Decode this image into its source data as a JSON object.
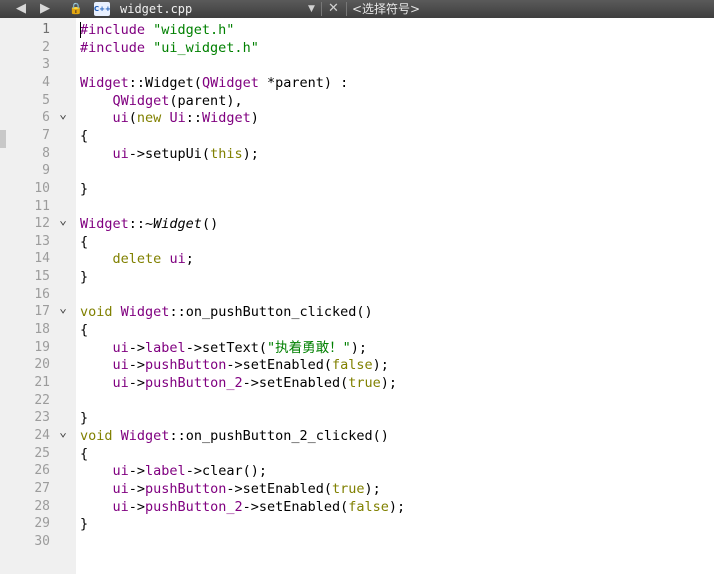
{
  "toolbar": {
    "back_icon": "◀",
    "forward_icon": "▶",
    "lock_icon": "🔒",
    "file_type_icon": "C++",
    "file_name": "widget.cpp",
    "dropdown_icon": "▼",
    "close_icon": "✕",
    "symbol_selector": "<选择符号>"
  },
  "editor": {
    "current_line": 1,
    "lines": [
      {
        "n": "1",
        "fold": "",
        "code": [
          [
            "t",
            "#include"
          ],
          [
            "",
            ""
          ],
          [
            "s",
            " \"widget.h\""
          ]
        ]
      },
      {
        "n": "2",
        "fold": "",
        "code": [
          [
            "t",
            "#include"
          ],
          [
            "s",
            " \"ui_widget.h\""
          ]
        ]
      },
      {
        "n": "3",
        "fold": "",
        "code": []
      },
      {
        "n": "4",
        "fold": "",
        "code": [
          [
            "t",
            "Widget"
          ],
          [
            "",
            "::Widget("
          ],
          [
            "t",
            "QWidget"
          ],
          [
            "",
            " *parent) :"
          ]
        ]
      },
      {
        "n": "5",
        "fold": "",
        "code": [
          [
            "",
            "    "
          ],
          [
            "t",
            "QWidget"
          ],
          [
            "",
            "(parent),"
          ]
        ]
      },
      {
        "n": "6",
        "fold": "v",
        "code": [
          [
            "",
            "    "
          ],
          [
            "t",
            "ui"
          ],
          [
            "",
            "("
          ],
          [
            "k",
            "new"
          ],
          [
            "",
            " "
          ],
          [
            "t",
            "Ui"
          ],
          [
            "",
            "::"
          ],
          [
            "t",
            "Widget"
          ],
          [
            "",
            ")"
          ]
        ]
      },
      {
        "n": "7",
        "fold": "",
        "code": [
          [
            "",
            "{"
          ]
        ]
      },
      {
        "n": "8",
        "fold": "",
        "code": [
          [
            "",
            "    "
          ],
          [
            "t",
            "ui"
          ],
          [
            "",
            "->setupUi("
          ],
          [
            "k",
            "this"
          ],
          [
            "",
            ");"
          ]
        ]
      },
      {
        "n": "9",
        "fold": "",
        "code": []
      },
      {
        "n": "10",
        "fold": "",
        "code": [
          [
            "",
            "}"
          ]
        ]
      },
      {
        "n": "11",
        "fold": "",
        "code": []
      },
      {
        "n": "12",
        "fold": "v",
        "code": [
          [
            "t",
            "Widget"
          ],
          [
            "",
            "::~"
          ],
          [
            "i",
            "Widget"
          ],
          [
            "",
            "()"
          ]
        ]
      },
      {
        "n": "13",
        "fold": "",
        "code": [
          [
            "",
            "{"
          ]
        ]
      },
      {
        "n": "14",
        "fold": "",
        "code": [
          [
            "",
            "    "
          ],
          [
            "k",
            "delete"
          ],
          [
            "",
            " "
          ],
          [
            "t",
            "ui"
          ],
          [
            "",
            ";"
          ]
        ]
      },
      {
        "n": "15",
        "fold": "",
        "code": [
          [
            "",
            "}"
          ]
        ]
      },
      {
        "n": "16",
        "fold": "",
        "code": []
      },
      {
        "n": "17",
        "fold": "v",
        "code": [
          [
            "k",
            "void"
          ],
          [
            "",
            " "
          ],
          [
            "t",
            "Widget"
          ],
          [
            "",
            "::on_pushButton_clicked()"
          ]
        ]
      },
      {
        "n": "18",
        "fold": "",
        "code": [
          [
            "",
            "{"
          ]
        ]
      },
      {
        "n": "19",
        "fold": "",
        "code": [
          [
            "",
            "    "
          ],
          [
            "t",
            "ui"
          ],
          [
            "",
            "->"
          ],
          [
            "t",
            "label"
          ],
          [
            "",
            "->setText("
          ],
          [
            "s",
            "\"执着勇敢！\""
          ],
          [
            "",
            ");"
          ]
        ]
      },
      {
        "n": "20",
        "fold": "",
        "code": [
          [
            "",
            "    "
          ],
          [
            "t",
            "ui"
          ],
          [
            "",
            "->"
          ],
          [
            "t",
            "pushButton"
          ],
          [
            "",
            "->setEnabled("
          ],
          [
            "k",
            "false"
          ],
          [
            "",
            ");"
          ]
        ]
      },
      {
        "n": "21",
        "fold": "",
        "code": [
          [
            "",
            "    "
          ],
          [
            "t",
            "ui"
          ],
          [
            "",
            "->"
          ],
          [
            "t",
            "pushButton_2"
          ],
          [
            "",
            "->setEnabled("
          ],
          [
            "k",
            "true"
          ],
          [
            "",
            ");"
          ]
        ]
      },
      {
        "n": "22",
        "fold": "",
        "code": []
      },
      {
        "n": "23",
        "fold": "",
        "code": [
          [
            "",
            "}"
          ]
        ]
      },
      {
        "n": "24",
        "fold": "v",
        "code": [
          [
            "k",
            "void"
          ],
          [
            "",
            " "
          ],
          [
            "t",
            "Widget"
          ],
          [
            "",
            "::on_pushButton_2_clicked()"
          ]
        ]
      },
      {
        "n": "25",
        "fold": "",
        "code": [
          [
            "",
            "{"
          ]
        ]
      },
      {
        "n": "26",
        "fold": "",
        "code": [
          [
            "",
            "    "
          ],
          [
            "t",
            "ui"
          ],
          [
            "",
            "->"
          ],
          [
            "t",
            "label"
          ],
          [
            "",
            "->clear();"
          ]
        ]
      },
      {
        "n": "27",
        "fold": "",
        "code": [
          [
            "",
            "    "
          ],
          [
            "t",
            "ui"
          ],
          [
            "",
            "->"
          ],
          [
            "t",
            "pushButton"
          ],
          [
            "",
            "->setEnabled("
          ],
          [
            "k",
            "true"
          ],
          [
            "",
            ");"
          ]
        ]
      },
      {
        "n": "28",
        "fold": "",
        "code": [
          [
            "",
            "    "
          ],
          [
            "t",
            "ui"
          ],
          [
            "",
            "->"
          ],
          [
            "t",
            "pushButton_2"
          ],
          [
            "",
            "->setEnabled("
          ],
          [
            "k",
            "false"
          ],
          [
            "",
            ");"
          ]
        ]
      },
      {
        "n": "29",
        "fold": "",
        "code": [
          [
            "",
            "}"
          ]
        ]
      },
      {
        "n": "30",
        "fold": "",
        "code": []
      }
    ]
  }
}
